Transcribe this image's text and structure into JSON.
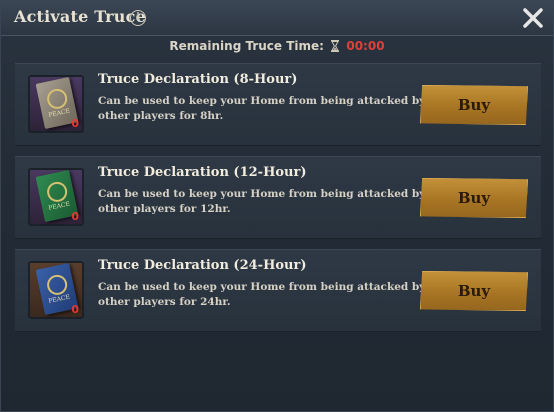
{
  "dialog": {
    "title": "Activate Truce",
    "remaining_label": "Remaining Truce Time:",
    "remaining_time": "00:00"
  },
  "items": [
    {
      "title": "Truce Declaration (8-Hour)",
      "desc": "Can be used to keep your Home from being attacked by other players for 8hr.",
      "count": "0",
      "buy_label": "Buy",
      "book_label": "PEACE"
    },
    {
      "title": "Truce Declaration (12-Hour)",
      "desc": "Can be used to keep your Home from being attacked by other players for 12hr.",
      "count": "0",
      "buy_label": "Buy",
      "book_label": "PEACE"
    },
    {
      "title": "Truce Declaration (24-Hour)",
      "desc": "Can be used to keep your Home from being attacked by other players for 24hr.",
      "count": "0",
      "buy_label": "Buy",
      "book_label": "PEACE"
    }
  ],
  "colors": {
    "timer": "#e0403a",
    "count": "#e23a33",
    "buy_button": "#a87524"
  },
  "icons": [
    "info-icon",
    "close-icon",
    "hourglass-icon",
    "truce-book-icon"
  ]
}
